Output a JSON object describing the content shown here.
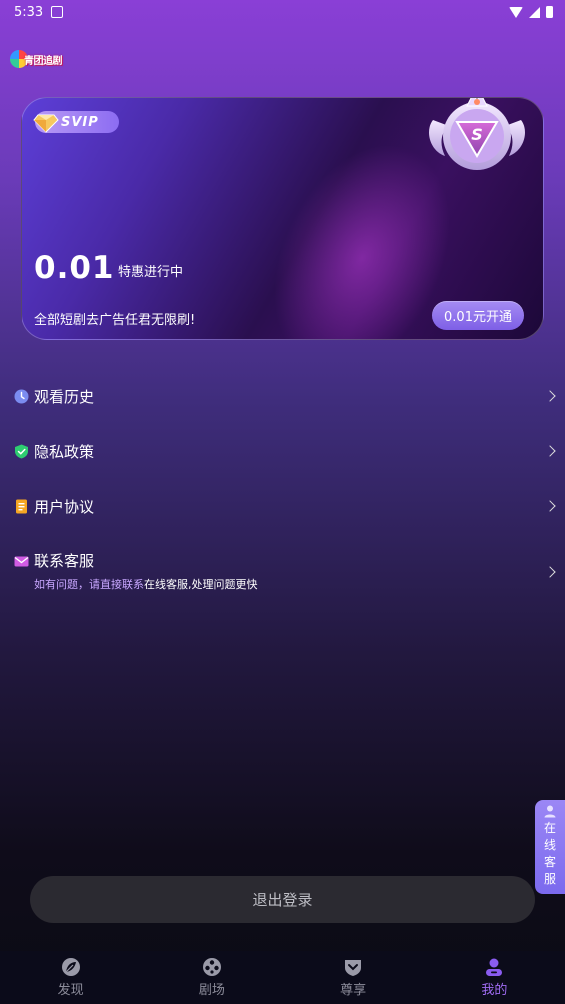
{
  "status_bar": {
    "time": "5:33"
  },
  "logo": {
    "text": "青团追剧"
  },
  "vip_card": {
    "badge": "SVIP",
    "price": "0.01",
    "promo": "特惠进行中",
    "description": "全部短剧去广告任君无限刷!",
    "open_button": "0.01元开通"
  },
  "menu": {
    "items": [
      {
        "label": "观看历史",
        "icon": "clock-icon"
      },
      {
        "label": "隐私政策",
        "icon": "shield-check-icon"
      },
      {
        "label": "用户协议",
        "icon": "document-icon"
      },
      {
        "label": "联系客服",
        "icon": "mail-icon"
      }
    ],
    "contact_sub_prefix": "如有问题，请直接联系",
    "contact_sub_suffix": "在线客服,处理问题更快"
  },
  "float_service": {
    "chars": [
      "在",
      "线",
      "客",
      "服"
    ]
  },
  "logout": {
    "label": "退出登录"
  },
  "nav": {
    "items": [
      {
        "label": "发现",
        "icon": "leaf-icon"
      },
      {
        "label": "剧场",
        "icon": "film-reel-icon"
      },
      {
        "label": "尊享",
        "icon": "heart-badge-icon"
      },
      {
        "label": "我的",
        "icon": "person-icon"
      }
    ],
    "active_index": 3
  },
  "colors": {
    "accent": "#a06cf2",
    "card_button": "#7e5fe6"
  }
}
